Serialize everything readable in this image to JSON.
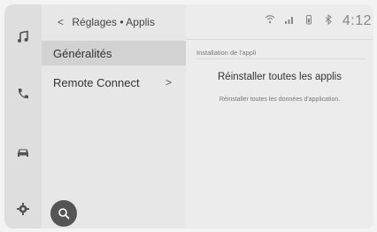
{
  "breadcrumb": {
    "back_glyph": "<",
    "label": "Réglages • Applis"
  },
  "status_bar": {
    "icons": [
      "wifi-icon",
      "signal-icon",
      "phone-battery-icon",
      "bluetooth-icon"
    ],
    "time": "4:12"
  },
  "sidebar": {
    "icons": [
      "music-icon",
      "phone-icon",
      "car-icon",
      "settings-gear-icon"
    ],
    "search_icon": "search-icon"
  },
  "menu": {
    "items": [
      {
        "label": "Généralités",
        "selected": true
      },
      {
        "label": "Remote Connect",
        "arrow": ">"
      }
    ]
  },
  "main": {
    "section_label": "Installation de l'appli",
    "action_title": "Réinstaller toutes les applis",
    "action_description": "Réinstaller toutes les données d'application."
  }
}
